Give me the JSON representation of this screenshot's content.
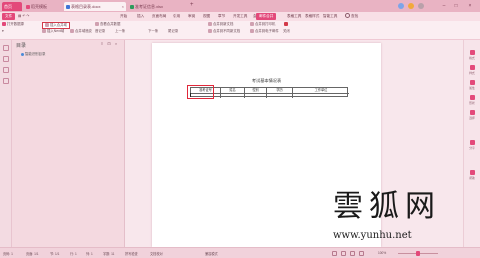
{
  "colors": {
    "accent": "#e3497a",
    "selection": "#e0283a",
    "page": "#ffffff",
    "panel": "#f4d9e0"
  },
  "tabs": [
    {
      "label": "首页",
      "icon": "home-icon"
    },
    {
      "label": "稻壳模板",
      "icon": "docer-icon"
    },
    {
      "label": "表格目录表.docx",
      "icon": "word-doc-icon"
    },
    {
      "label": "准考证信息.xlsx",
      "icon": "excel-doc-icon"
    }
  ],
  "menu": {
    "file": "文件",
    "items": [
      "开始",
      "插入",
      "页面布局",
      "引用",
      "审阅",
      "视图",
      "章节",
      "开发工具",
      "会员专享",
      "表格工具",
      "表格样式",
      "智能工具"
    ],
    "active": "邮件合并",
    "search": "查找"
  },
  "ribbon": {
    "open_source": "打开数据源",
    "insert_merge_field": "插入合并域",
    "insert_next_field": "插入Next域",
    "highlight_fields": "合并域底纹",
    "view_merged": "查看合并数据",
    "first": "首记录",
    "prev": "上一条",
    "next": "下一条",
    "last": "尾记录",
    "merge_to_new": "合并到新文档",
    "merge_to_separate": "合并到不同新文档",
    "merge_to_printer": "合并到打印机",
    "merge_to_email": "合并到电子邮件",
    "close": "关闭"
  },
  "nav": {
    "title": "目录",
    "item": "智能识别目录"
  },
  "document": {
    "title": "考试基本情况表",
    "headers": [
      "准考证号",
      "姓名",
      "性别",
      "学历",
      "工作单位"
    ]
  },
  "right_rail": [
    "格式",
    "样式",
    "属性",
    "形状",
    "选择",
    "分享",
    "帮助"
  ],
  "status": {
    "page": "页码: 1",
    "pages": "页面: 1/1",
    "section": "节: 1/1",
    "row": "行: 1",
    "column": "列: 1",
    "word_count": "字数: 11",
    "spell_check": "拼写检查",
    "doc_proof": "文档校对",
    "compat": "兼容模式",
    "zoom": "100%"
  },
  "watermark": {
    "cjk": "雲狐网",
    "url": "www.yunhu.net"
  }
}
